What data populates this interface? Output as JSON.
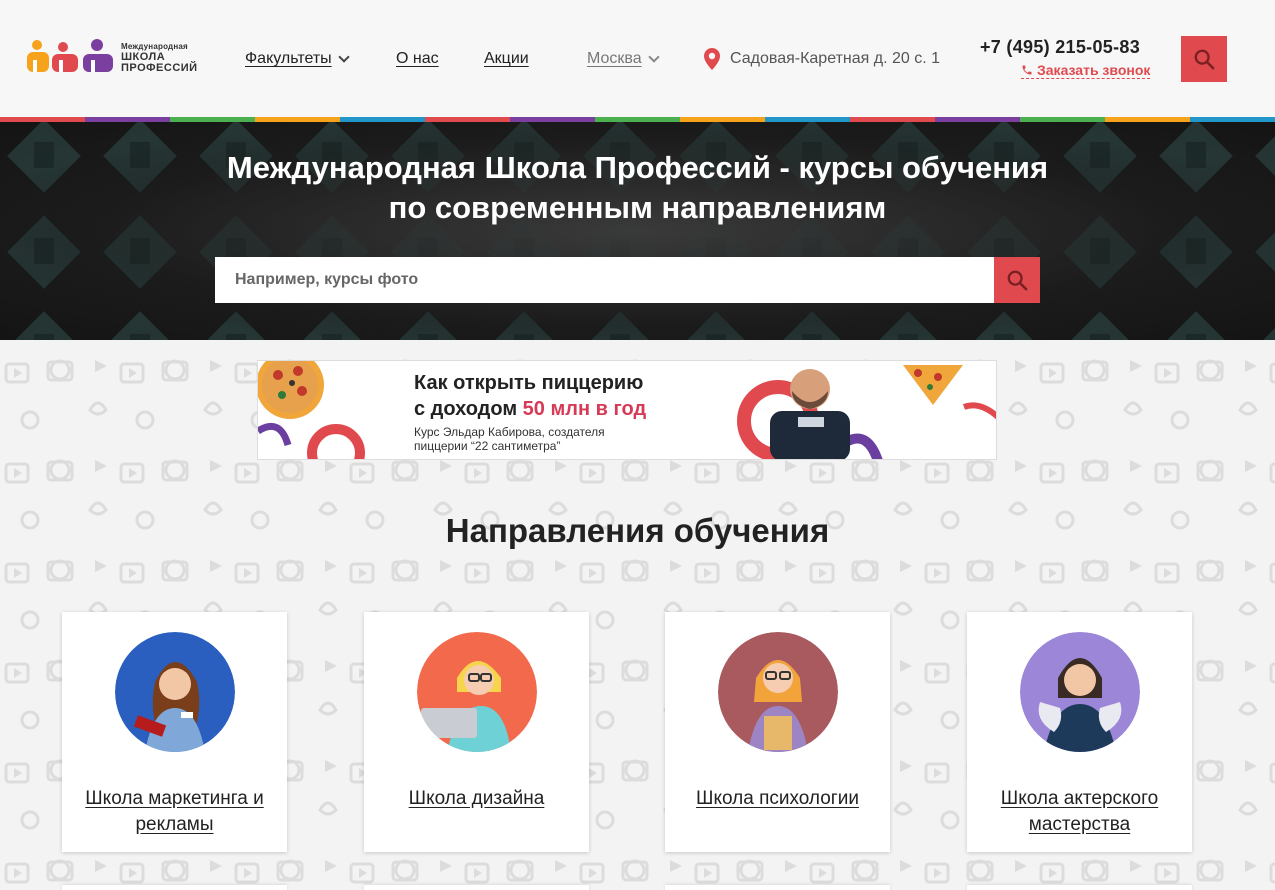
{
  "header": {
    "logo": {
      "line1": "Международная",
      "line2": "ШКОЛА",
      "line3": "ПРОФЕССИЙ",
      "colors": [
        "#f7a21b",
        "#e04a4f",
        "#7b3fa0"
      ]
    },
    "nav": [
      {
        "label": "Факультеты",
        "has_dropdown": true
      },
      {
        "label": "О нас",
        "has_dropdown": false
      },
      {
        "label": "Акции",
        "has_dropdown": false
      }
    ],
    "city": {
      "label": "Москва",
      "has_dropdown": true
    },
    "address": "Садовая-Каретная д. 20 с. 1",
    "address_icon": "map-pin-icon",
    "phone": "+7 (495) 215-05-83",
    "callback_label": "Заказать звонок",
    "callback_icon": "phone-icon",
    "search_icon": "search-icon",
    "accent_color": "#e04a4f"
  },
  "stripe_colors": [
    "#e04a4f",
    "#7b3fa0",
    "#4caf50",
    "#f7a21b",
    "#2196c9",
    "#e04a4f",
    "#7b3fa0",
    "#4caf50",
    "#f7a21b",
    "#2196c9",
    "#e04a4f",
    "#7b3fa0",
    "#4caf50",
    "#f7a21b",
    "#2196c9"
  ],
  "hero": {
    "title_line1": "Международная Школа Профессий - курсы обучения",
    "title_line2": "по современным направлениям",
    "search_placeholder": "Например, курсы фото",
    "search_icon": "search-icon"
  },
  "banner": {
    "headline_line1": "Как открыть пиццерию",
    "headline_line2_prefix": "с доходом ",
    "headline_line2_accent": "50 млн в год",
    "sub_line1": "Курс Эльдар Кабирова, создателя",
    "sub_line2": "пиццерии “22 сантиметра”"
  },
  "section_title": "Направления обучения",
  "cards": [
    {
      "label": "Школа маркетинга и рекламы",
      "avatar_bg": "#2b5fbf"
    },
    {
      "label": "Школа дизайна",
      "avatar_bg": "#f26a4b"
    },
    {
      "label": "Школа психологии",
      "avatar_bg": "#a85a5f"
    },
    {
      "label": "Школа актерского мастерства",
      "avatar_bg": "#9b86d8"
    }
  ]
}
